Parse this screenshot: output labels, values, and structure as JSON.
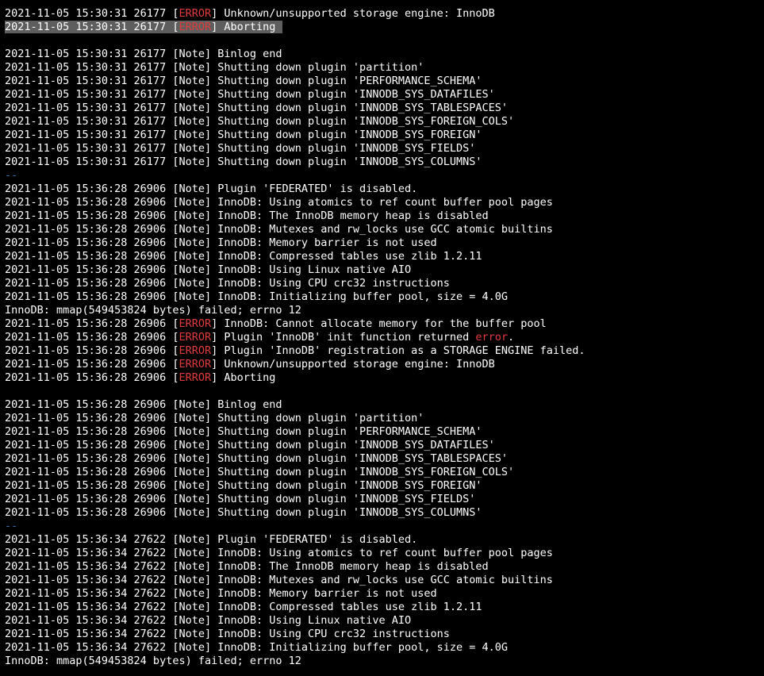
{
  "terminal": {
    "colors": {
      "background": "#000000",
      "text": "#ffffff",
      "error": "#e03c3c",
      "separator": "#3a6ea5",
      "selection": "#5e5e5e"
    },
    "lines": [
      {
        "type": "log",
        "prefix": "2021-11-05 15:30:31 26177 ",
        "level": "ERROR",
        "msg": " Unknown/unsupported storage engine: InnoDB"
      },
      {
        "type": "log",
        "prefix": "2021-11-05 15:30:31 26177 ",
        "level": "ERROR",
        "msg": " Aborting",
        "selected": true
      },
      {
        "type": "blank"
      },
      {
        "type": "log",
        "prefix": "2021-11-05 15:30:31 26177 ",
        "level": "Note",
        "msg": " Binlog end"
      },
      {
        "type": "log",
        "prefix": "2021-11-05 15:30:31 26177 ",
        "level": "Note",
        "msg": " Shutting down plugin 'partition'"
      },
      {
        "type": "log",
        "prefix": "2021-11-05 15:30:31 26177 ",
        "level": "Note",
        "msg": " Shutting down plugin 'PERFORMANCE_SCHEMA'"
      },
      {
        "type": "log",
        "prefix": "2021-11-05 15:30:31 26177 ",
        "level": "Note",
        "msg": " Shutting down plugin 'INNODB_SYS_DATAFILES'"
      },
      {
        "type": "log",
        "prefix": "2021-11-05 15:30:31 26177 ",
        "level": "Note",
        "msg": " Shutting down plugin 'INNODB_SYS_TABLESPACES'"
      },
      {
        "type": "log",
        "prefix": "2021-11-05 15:30:31 26177 ",
        "level": "Note",
        "msg": " Shutting down plugin 'INNODB_SYS_FOREIGN_COLS'"
      },
      {
        "type": "log",
        "prefix": "2021-11-05 15:30:31 26177 ",
        "level": "Note",
        "msg": " Shutting down plugin 'INNODB_SYS_FOREIGN'"
      },
      {
        "type": "log",
        "prefix": "2021-11-05 15:30:31 26177 ",
        "level": "Note",
        "msg": " Shutting down plugin 'INNODB_SYS_FIELDS'"
      },
      {
        "type": "log",
        "prefix": "2021-11-05 15:30:31 26177 ",
        "level": "Note",
        "msg": " Shutting down plugin 'INNODB_SYS_COLUMNS'"
      },
      {
        "type": "sep",
        "text": "--"
      },
      {
        "type": "log",
        "prefix": "2021-11-05 15:36:28 26906 ",
        "level": "Note",
        "msg": " Plugin 'FEDERATED' is disabled."
      },
      {
        "type": "log",
        "prefix": "2021-11-05 15:36:28 26906 ",
        "level": "Note",
        "msg": " InnoDB: Using atomics to ref count buffer pool pages"
      },
      {
        "type": "log",
        "prefix": "2021-11-05 15:36:28 26906 ",
        "level": "Note",
        "msg": " InnoDB: The InnoDB memory heap is disabled"
      },
      {
        "type": "log",
        "prefix": "2021-11-05 15:36:28 26906 ",
        "level": "Note",
        "msg": " InnoDB: Mutexes and rw_locks use GCC atomic builtins"
      },
      {
        "type": "log",
        "prefix": "2021-11-05 15:36:28 26906 ",
        "level": "Note",
        "msg": " InnoDB: Memory barrier is not used"
      },
      {
        "type": "log",
        "prefix": "2021-11-05 15:36:28 26906 ",
        "level": "Note",
        "msg": " InnoDB: Compressed tables use zlib 1.2.11"
      },
      {
        "type": "log",
        "prefix": "2021-11-05 15:36:28 26906 ",
        "level": "Note",
        "msg": " InnoDB: Using Linux native AIO"
      },
      {
        "type": "log",
        "prefix": "2021-11-05 15:36:28 26906 ",
        "level": "Note",
        "msg": " InnoDB: Using CPU crc32 instructions"
      },
      {
        "type": "log",
        "prefix": "2021-11-05 15:36:28 26906 ",
        "level": "Note",
        "msg": " InnoDB: Initializing buffer pool, size = 4.0G"
      },
      {
        "type": "plain",
        "text": "InnoDB: mmap(549453824 bytes) failed; errno 12"
      },
      {
        "type": "log",
        "prefix": "2021-11-05 15:36:28 26906 ",
        "level": "ERROR",
        "msg": " InnoDB: Cannot allocate memory for the buffer pool"
      },
      {
        "type": "log",
        "prefix": "2021-11-05 15:36:28 26906 ",
        "level": "ERROR",
        "msg": " Plugin 'InnoDB' init function returned ",
        "msgErr": "error",
        "msgTail": "."
      },
      {
        "type": "log",
        "prefix": "2021-11-05 15:36:28 26906 ",
        "level": "ERROR",
        "msg": " Plugin 'InnoDB' registration as a STORAGE ENGINE failed."
      },
      {
        "type": "log",
        "prefix": "2021-11-05 15:36:28 26906 ",
        "level": "ERROR",
        "msg": " Unknown/unsupported storage engine: InnoDB"
      },
      {
        "type": "log",
        "prefix": "2021-11-05 15:36:28 26906 ",
        "level": "ERROR",
        "msg": " Aborting"
      },
      {
        "type": "blank"
      },
      {
        "type": "log",
        "prefix": "2021-11-05 15:36:28 26906 ",
        "level": "Note",
        "msg": " Binlog end"
      },
      {
        "type": "log",
        "prefix": "2021-11-05 15:36:28 26906 ",
        "level": "Note",
        "msg": " Shutting down plugin 'partition'"
      },
      {
        "type": "log",
        "prefix": "2021-11-05 15:36:28 26906 ",
        "level": "Note",
        "msg": " Shutting down plugin 'PERFORMANCE_SCHEMA'"
      },
      {
        "type": "log",
        "prefix": "2021-11-05 15:36:28 26906 ",
        "level": "Note",
        "msg": " Shutting down plugin 'INNODB_SYS_DATAFILES'"
      },
      {
        "type": "log",
        "prefix": "2021-11-05 15:36:28 26906 ",
        "level": "Note",
        "msg": " Shutting down plugin 'INNODB_SYS_TABLESPACES'"
      },
      {
        "type": "log",
        "prefix": "2021-11-05 15:36:28 26906 ",
        "level": "Note",
        "msg": " Shutting down plugin 'INNODB_SYS_FOREIGN_COLS'"
      },
      {
        "type": "log",
        "prefix": "2021-11-05 15:36:28 26906 ",
        "level": "Note",
        "msg": " Shutting down plugin 'INNODB_SYS_FOREIGN'"
      },
      {
        "type": "log",
        "prefix": "2021-11-05 15:36:28 26906 ",
        "level": "Note",
        "msg": " Shutting down plugin 'INNODB_SYS_FIELDS'"
      },
      {
        "type": "log",
        "prefix": "2021-11-05 15:36:28 26906 ",
        "level": "Note",
        "msg": " Shutting down plugin 'INNODB_SYS_COLUMNS'"
      },
      {
        "type": "sep",
        "text": "--"
      },
      {
        "type": "log",
        "prefix": "2021-11-05 15:36:34 27622 ",
        "level": "Note",
        "msg": " Plugin 'FEDERATED' is disabled."
      },
      {
        "type": "log",
        "prefix": "2021-11-05 15:36:34 27622 ",
        "level": "Note",
        "msg": " InnoDB: Using atomics to ref count buffer pool pages"
      },
      {
        "type": "log",
        "prefix": "2021-11-05 15:36:34 27622 ",
        "level": "Note",
        "msg": " InnoDB: The InnoDB memory heap is disabled"
      },
      {
        "type": "log",
        "prefix": "2021-11-05 15:36:34 27622 ",
        "level": "Note",
        "msg": " InnoDB: Mutexes and rw_locks use GCC atomic builtins"
      },
      {
        "type": "log",
        "prefix": "2021-11-05 15:36:34 27622 ",
        "level": "Note",
        "msg": " InnoDB: Memory barrier is not used"
      },
      {
        "type": "log",
        "prefix": "2021-11-05 15:36:34 27622 ",
        "level": "Note",
        "msg": " InnoDB: Compressed tables use zlib 1.2.11"
      },
      {
        "type": "log",
        "prefix": "2021-11-05 15:36:34 27622 ",
        "level": "Note",
        "msg": " InnoDB: Using Linux native AIO"
      },
      {
        "type": "log",
        "prefix": "2021-11-05 15:36:34 27622 ",
        "level": "Note",
        "msg": " InnoDB: Using CPU crc32 instructions"
      },
      {
        "type": "log",
        "prefix": "2021-11-05 15:36:34 27622 ",
        "level": "Note",
        "msg": " InnoDB: Initializing buffer pool, size = 4.0G"
      },
      {
        "type": "plain",
        "text": "InnoDB: mmap(549453824 bytes) failed; errno 12"
      }
    ]
  }
}
